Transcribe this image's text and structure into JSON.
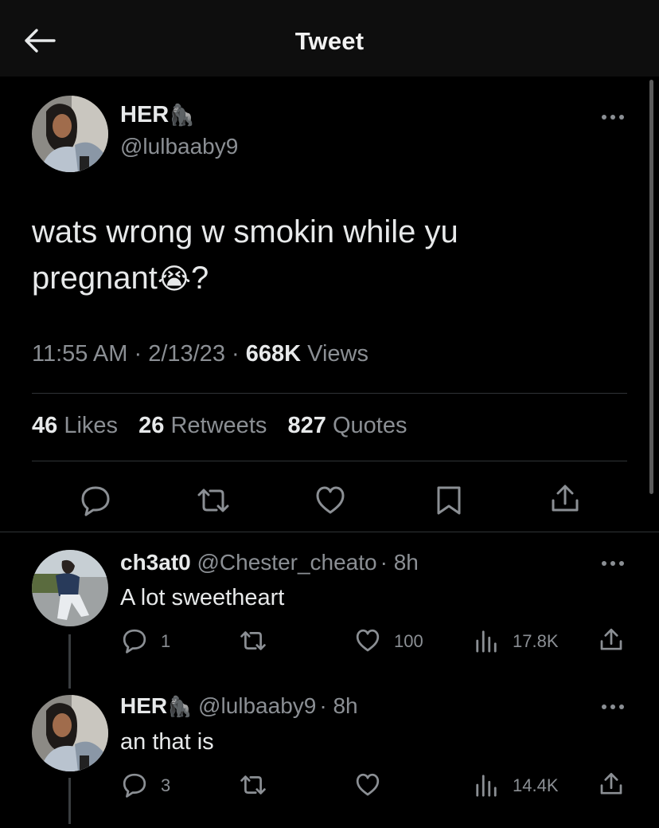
{
  "header": {
    "title": "Tweet"
  },
  "main_tweet": {
    "display_name": "HER",
    "name_emoji": "🦍",
    "handle": "@lulbaaby9",
    "text_line1": "wats wrong w smokin while yu",
    "text_line2": "pregnant",
    "text_emoji": "😭",
    "text_end": "?",
    "time": "11:55 AM",
    "date": "2/13/23",
    "sep1": "·",
    "sep2": "·",
    "views_count": "668K",
    "views_label": "Views",
    "likes_count": "46",
    "likes_label": "Likes",
    "retweets_count": "26",
    "retweets_label": "Retweets",
    "quotes_count": "827",
    "quotes_label": "Quotes"
  },
  "replies": [
    {
      "display_name": "ch3at0",
      "handle": "@Chester_cheato",
      "sep": "·",
      "time": "8h",
      "text": "A lot sweetheart",
      "reply_count": "1",
      "like_count": "100",
      "view_count": "17.8K"
    },
    {
      "display_name": "HER",
      "name_emoji": "🦍",
      "handle": "@lulbaaby9",
      "sep": "·",
      "time": "8h",
      "text": "an that is",
      "reply_count": "3",
      "view_count": "14.4K"
    }
  ],
  "colors": {
    "background": "#000000",
    "text": "#e7e9ea",
    "muted": "#8b8f94",
    "divider": "#2f3336"
  },
  "icons": [
    "back-arrow-icon",
    "more-icon",
    "reply-icon",
    "retweet-icon",
    "like-icon",
    "bookmark-icon",
    "share-icon",
    "views-icon"
  ]
}
